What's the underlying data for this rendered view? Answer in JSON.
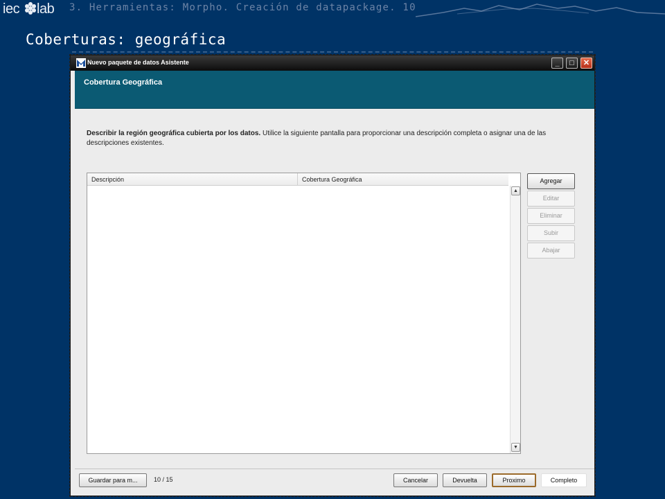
{
  "slide": {
    "logo_text": "iec*lab",
    "breadcrumb": "3. Herramientas: Morpho. Creación de datapackage. 10",
    "title": "Coberturas: geográfica"
  },
  "window": {
    "title": "Nuevo paquete de datos Asistente",
    "controls": {
      "minimize": "_",
      "maximize": "□",
      "close": "✕"
    },
    "banner_title": "Cobertura Geográfica",
    "instructions_bold": "Describir la región geográfica cubierta por los datos.",
    "instructions_rest": " Utilice la siguiente pantalla para proporcionar una descripción completa o asignar una de las descripciones existentes.",
    "table": {
      "columns": [
        "Descripción",
        "Cobertura Geográfica"
      ],
      "rows": []
    },
    "side_buttons": [
      {
        "label": "Agregar",
        "enabled": true
      },
      {
        "label": "Editar",
        "enabled": false
      },
      {
        "label": "Eliminar",
        "enabled": false
      },
      {
        "label": "Subir",
        "enabled": false
      },
      {
        "label": "Abajar",
        "enabled": false
      }
    ],
    "footer": {
      "save_label": "Guardar para m...",
      "page_counter": "10 / 15",
      "cancel_label": "Cancelar",
      "back_label": "Devuelta",
      "next_label": "Proximo",
      "finish_label": "Completo"
    }
  },
  "colors": {
    "slide_background": "#003366",
    "banner": "#0b5a73",
    "titlebar": "#0c0c0c"
  }
}
